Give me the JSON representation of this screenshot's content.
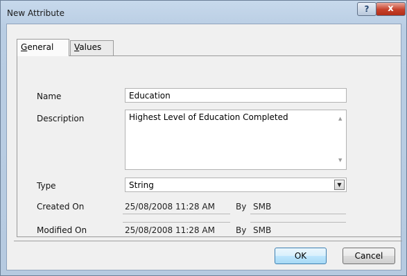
{
  "window": {
    "title": "New Attribute",
    "help_glyph": "?",
    "close_glyph": "x"
  },
  "tabs": [
    {
      "label": "General",
      "accel": "G",
      "rest": "eneral",
      "selected": true
    },
    {
      "label": "Values",
      "accel": "V",
      "rest": "alues",
      "selected": false
    }
  ],
  "form": {
    "name_label": "Name",
    "name_value": "Education",
    "description_label": "Description",
    "description_value": "Highest Level of Education Completed",
    "type_label": "Type",
    "type_value": "String",
    "created_label": "Created On",
    "created_value": "25/08/2008 11:28 AM",
    "created_by_label": "By",
    "created_by_value": "SMB",
    "modified_label": "Modified On",
    "modified_value": "25/08/2008 11:28 AM",
    "modified_by_label": "By",
    "modified_by_value": "SMB"
  },
  "buttons": {
    "ok_label": "OK",
    "cancel_label": "Cancel"
  },
  "icons": {
    "scroll_up": "▲",
    "scroll_down": "▼",
    "dropdown": "▼"
  },
  "colors": {
    "frame": "#b9cde3",
    "close_button": "#c6402a",
    "client": "#f0f0f0"
  }
}
